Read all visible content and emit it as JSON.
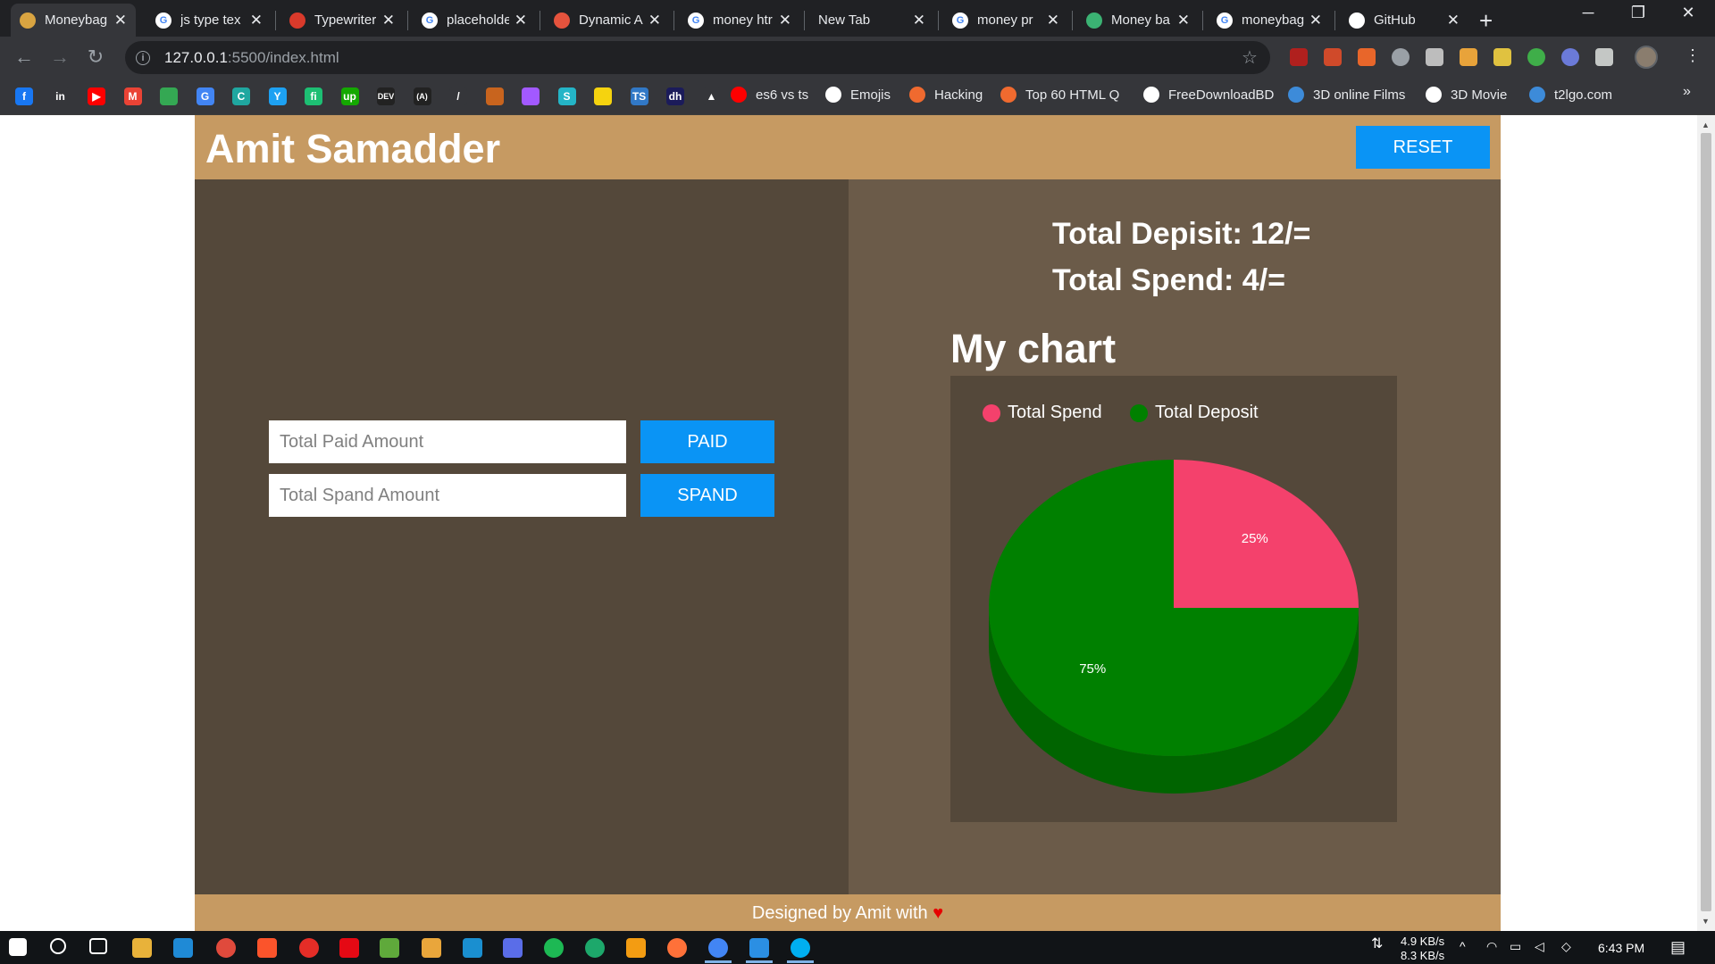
{
  "browser": {
    "tabs": [
      {
        "title": "Moneybag",
        "favicon_color": "#d9a441",
        "active": true
      },
      {
        "title": "js type tex",
        "favicon_color": "#ffffff",
        "favicon_letter": "G"
      },
      {
        "title": "Typewriter",
        "favicon_color": "#d93a2b"
      },
      {
        "title": "placeholde",
        "favicon_color": "#ffffff",
        "favicon_letter": "G"
      },
      {
        "title": "Dynamic A",
        "favicon_color": "#e5533d"
      },
      {
        "title": "money htr",
        "favicon_color": "#ffffff",
        "favicon_letter": "G"
      },
      {
        "title": "New Tab",
        "favicon_color": ""
      },
      {
        "title": "money pr",
        "favicon_color": "#ffffff",
        "favicon_letter": "G"
      },
      {
        "title": "Money ba",
        "favicon_color": "#3bb273"
      },
      {
        "title": "moneybag",
        "favicon_color": "#ffffff",
        "favicon_letter": "G"
      },
      {
        "title": "GitHub",
        "favicon_color": "#ffffff"
      }
    ],
    "url_host": "127.0.0.1",
    "url_path": ":5500/index.html",
    "bookmarks": [
      {
        "label": "es6 vs ts",
        "icon_color": "#ff0000"
      },
      {
        "label": "Emojis",
        "icon_color": "#ffffff"
      },
      {
        "label": "Hacking",
        "icon_color": "#f06a2f"
      },
      {
        "label": "Top 60 HTML Q",
        "icon_color": "#f06a2f"
      },
      {
        "label": "FreeDownloadBD",
        "icon_color": "#ffffff"
      },
      {
        "label": "3D online Films",
        "icon_color": "#3d8bd9"
      },
      {
        "label": "3D Movie",
        "icon_color": "#ffffff"
      },
      {
        "label": "t2lgo.com",
        "icon_color": "#3d8bd9"
      }
    ],
    "bookmark_icons": [
      {
        "name": "facebook-icon",
        "color": "#1877f2",
        "text": "f"
      },
      {
        "name": "linkedin-icon",
        "color": "#35363a",
        "text": "in"
      },
      {
        "name": "youtube-icon",
        "color": "#ff0000",
        "text": "▶"
      },
      {
        "name": "gmail-icon",
        "color": "#ea4335",
        "text": "M"
      },
      {
        "name": "maps-icon",
        "color": "#34a853",
        "text": ""
      },
      {
        "name": "translate-icon",
        "color": "#4285f4",
        "text": "G"
      },
      {
        "name": "chat-icon",
        "color": "#1fa7a0",
        "text": "C"
      },
      {
        "name": "twitter-icon",
        "color": "#1da1f2",
        "text": "Y"
      },
      {
        "name": "fiverr-icon",
        "color": "#1dbf73",
        "text": "fi"
      },
      {
        "name": "upwork-icon",
        "color": "#14a800",
        "text": "up"
      },
      {
        "name": "dev-icon",
        "color": "#222222",
        "text": "DEV"
      },
      {
        "name": "a-icon",
        "color": "#222222",
        "text": "(A)"
      },
      {
        "name": "feather-icon",
        "color": "#35363a",
        "text": "/"
      },
      {
        "name": "orange-icon",
        "color": "#c8641e",
        "text": ""
      },
      {
        "name": "figma-icon",
        "color": "#a259ff",
        "text": ""
      },
      {
        "name": "s-icon",
        "color": "#24b5c7",
        "text": "S"
      },
      {
        "name": "yellow-icon",
        "color": "#f5d30f",
        "text": ""
      },
      {
        "name": "ts-icon",
        "color": "#3178c6",
        "text": "TS"
      },
      {
        "name": "dh-icon",
        "color": "#1b1b5a",
        "text": "dh"
      },
      {
        "name": "pyramid-icon",
        "color": "#35363a",
        "text": "▲"
      }
    ],
    "more_label": "»"
  },
  "header": {
    "title": "Amit Samadder",
    "reset_label": "RESET"
  },
  "form": {
    "paid_placeholder": "Total Paid Amount",
    "paid_label": "PAID",
    "spend_placeholder": "Total Spand Amount",
    "spend_label": "SPAND"
  },
  "stats": {
    "deposit": "Total Depisit: 12/=",
    "spend": "Total Spend: 4/="
  },
  "chart_title": "My chart",
  "chart_data": {
    "type": "pie",
    "categories": [
      "Total Spend",
      "Total Deposit"
    ],
    "values": [
      4,
      12
    ],
    "percent_labels": [
      "25%",
      "75%"
    ],
    "colors": [
      "#f4416c",
      "#008000"
    ],
    "side_colors": [
      "#c23356",
      "#006400"
    ],
    "legend_position": "top",
    "style": "3d"
  },
  "footer": {
    "text": "Designed by Amit with",
    "heart": "♥"
  },
  "taskbar": {
    "net_down": "4.9 KB/s",
    "net_up": "8.3 KB/s",
    "clock": "6:43 PM"
  }
}
